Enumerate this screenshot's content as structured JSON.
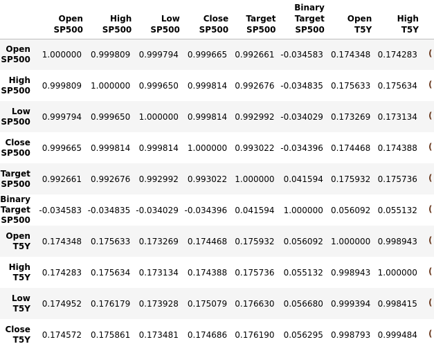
{
  "table": {
    "columns": [
      [
        "Open",
        "SP500"
      ],
      [
        "High",
        "SP500"
      ],
      [
        "Low",
        "SP500"
      ],
      [
        "Close",
        "SP500"
      ],
      [
        "Target",
        "SP500"
      ],
      [
        "Binary",
        "Target",
        "SP500"
      ],
      [
        "Open",
        "T5Y"
      ],
      [
        "High",
        "T5Y"
      ]
    ],
    "rows": [
      {
        "index": [
          "Open",
          "SP500"
        ],
        "values": [
          "1.000000",
          "0.999809",
          "0.999794",
          "0.999665",
          "0.992661",
          "-0.034583",
          "0.174348",
          "0.174283"
        ]
      },
      {
        "index": [
          "High",
          "SP500"
        ],
        "values": [
          "0.999809",
          "1.000000",
          "0.999650",
          "0.999814",
          "0.992676",
          "-0.034835",
          "0.175633",
          "0.175634"
        ]
      },
      {
        "index": [
          "Low",
          "SP500"
        ],
        "values": [
          "0.999794",
          "0.999650",
          "1.000000",
          "0.999814",
          "0.992992",
          "-0.034029",
          "0.173269",
          "0.173134"
        ]
      },
      {
        "index": [
          "Close",
          "SP500"
        ],
        "values": [
          "0.999665",
          "0.999814",
          "0.999814",
          "1.000000",
          "0.993022",
          "-0.034396",
          "0.174468",
          "0.174388"
        ]
      },
      {
        "index": [
          "Target",
          "SP500"
        ],
        "values": [
          "0.992661",
          "0.992676",
          "0.992992",
          "0.993022",
          "1.000000",
          "0.041594",
          "0.175932",
          "0.175736"
        ]
      },
      {
        "index": [
          "Binary",
          "Target",
          "SP500"
        ],
        "values": [
          "-0.034583",
          "-0.034835",
          "-0.034029",
          "-0.034396",
          "0.041594",
          "1.000000",
          "0.056092",
          "0.055132"
        ]
      },
      {
        "index": [
          "Open",
          "T5Y"
        ],
        "values": [
          "0.174348",
          "0.175633",
          "0.173269",
          "0.174468",
          "0.175932",
          "0.056092",
          "1.000000",
          "0.998943"
        ]
      },
      {
        "index": [
          "High",
          "T5Y"
        ],
        "values": [
          "0.174283",
          "0.175634",
          "0.173134",
          "0.174388",
          "0.175736",
          "0.055132",
          "0.998943",
          "1.000000"
        ]
      },
      {
        "index": [
          "Low",
          "T5Y"
        ],
        "values": [
          "0.174952",
          "0.176179",
          "0.173928",
          "0.175079",
          "0.176630",
          "0.056680",
          "0.999394",
          "0.998415"
        ]
      },
      {
        "index": [
          "Close",
          "T5Y"
        ],
        "values": [
          "0.174572",
          "0.175861",
          "0.173481",
          "0.174686",
          "0.176190",
          "0.056295",
          "0.998793",
          "0.999484"
        ]
      }
    ],
    "clipped_glyph": "("
  }
}
